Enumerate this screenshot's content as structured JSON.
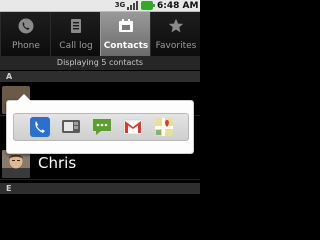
{
  "status_bar": {
    "network_label": "3G",
    "time": "6:48 AM",
    "icons": [
      "3g-icon",
      "signal-icon",
      "battery-icon"
    ],
    "battery_color": "#39a52f"
  },
  "tabs": [
    {
      "label": "Phone",
      "icon": "phone-icon",
      "active": false
    },
    {
      "label": "Call log",
      "icon": "call-log-icon",
      "active": false
    },
    {
      "label": "Contacts",
      "icon": "contacts-icon",
      "active": true
    },
    {
      "label": "Favorites",
      "icon": "star-icon",
      "active": false
    }
  ],
  "list": {
    "count_text": "Displaying 5 contacts",
    "sections": [
      "A",
      "E"
    ],
    "visible_contact": {
      "name": "Chris",
      "avatar": "avatar-photo"
    }
  },
  "quick_contact": {
    "actions": [
      {
        "name": "call-action",
        "icon": "phone-icon",
        "color": "#2b6fd1"
      },
      {
        "name": "message-action",
        "icon": "sms-icon",
        "color": "#6a6a6a"
      },
      {
        "name": "chat-action",
        "icon": "talk-bubble-icon",
        "color": "#5aa02c"
      },
      {
        "name": "email-action",
        "icon": "gmail-icon",
        "color": "#d83a2c"
      },
      {
        "name": "map-action",
        "icon": "maps-icon",
        "color": "#d9c050"
      }
    ]
  },
  "colors": {
    "active_tab": "#8a8a8a",
    "background": "#000000",
    "popup": "#fdfdfd"
  }
}
